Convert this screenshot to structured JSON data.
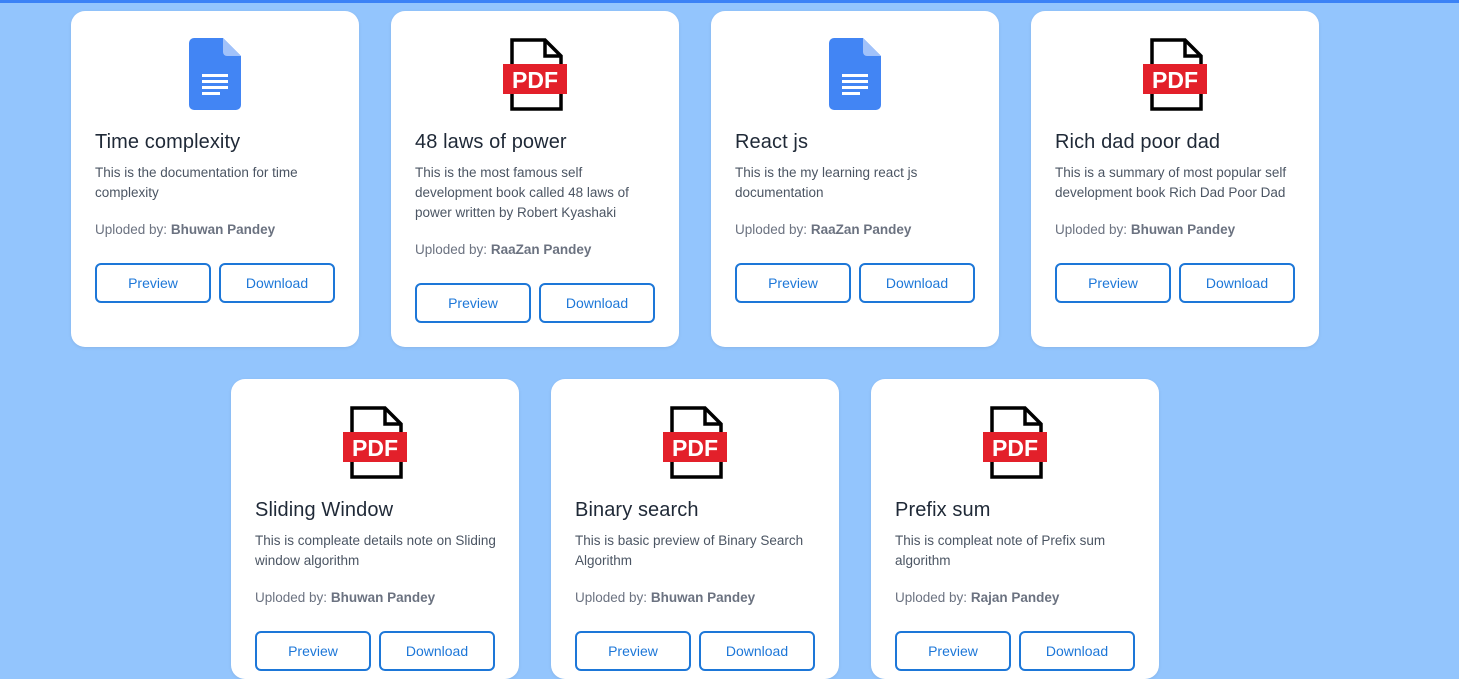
{
  "labels": {
    "uploaded_by": "Uploded by:",
    "preview": "Preview",
    "download": "Download"
  },
  "colors": {
    "background": "#93c5fd",
    "accent": "#1d77d8",
    "pdf_red": "#e3202a",
    "doc_blue": "#4285f4"
  },
  "cards": [
    {
      "icon": "doc-icon",
      "title": "Time complexity",
      "description": "This is the documentation for time complexity",
      "uploader": "Bhuwan Pandey"
    },
    {
      "icon": "pdf-icon",
      "title": "48 laws of power",
      "description": "This is the most famous self development book called 48 laws of power written by Robert Kyashaki",
      "uploader": "RaaZan Pandey"
    },
    {
      "icon": "doc-icon",
      "title": "React js",
      "description": "This is the my learning react js documentation",
      "uploader": "RaaZan Pandey"
    },
    {
      "icon": "pdf-icon",
      "title": "Rich dad poor dad",
      "description": "This is a summary of most popular self development book Rich Dad Poor Dad",
      "uploader": "Bhuwan Pandey"
    },
    {
      "icon": "pdf-icon",
      "title": "Sliding Window",
      "description": "This is compleate details note on Sliding window algorithm",
      "uploader": "Bhuwan Pandey"
    },
    {
      "icon": "pdf-icon",
      "title": "Binary search",
      "description": "This is basic preview of Binary Search Algorithm",
      "uploader": "Bhuwan Pandey"
    },
    {
      "icon": "pdf-icon",
      "title": "Prefix sum",
      "description": "This is compleat note of Prefix sum algorithm",
      "uploader": "Rajan Pandey"
    }
  ]
}
